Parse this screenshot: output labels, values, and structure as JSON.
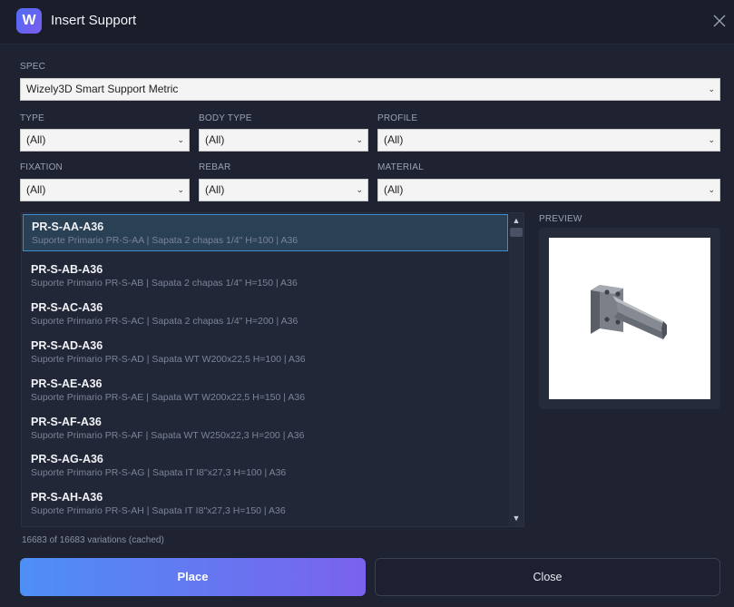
{
  "window": {
    "title": "Insert Support",
    "app_icon_letter": "W"
  },
  "spec": {
    "label": "SPEC",
    "value": "Wizely3D Smart Support Metric"
  },
  "filters": {
    "type": {
      "label": "TYPE",
      "value": "(All)"
    },
    "body_type": {
      "label": "BODY TYPE",
      "value": "(All)"
    },
    "profile": {
      "label": "PROFILE",
      "value": "(All)"
    },
    "fixation": {
      "label": "FIXATION",
      "value": "(All)"
    },
    "rebar": {
      "label": "REBAR",
      "value": "(All)"
    },
    "material": {
      "label": "MATERIAL",
      "value": "(All)"
    }
  },
  "list": {
    "selected_index": 0,
    "items": [
      {
        "code": "PR-S-AA-A36",
        "desc": "Suporte Primario PR-S-AA | Sapata 2 chapas 1/4\" H=100 | A36"
      },
      {
        "code": "PR-S-AB-A36",
        "desc": "Suporte Primario PR-S-AB | Sapata 2 chapas 1/4\" H=150 | A36"
      },
      {
        "code": "PR-S-AC-A36",
        "desc": "Suporte Primario PR-S-AC | Sapata 2 chapas 1/4\" H=200 | A36"
      },
      {
        "code": "PR-S-AD-A36",
        "desc": "Suporte Primario PR-S-AD | Sapata WT W200x22,5 H=100 | A36"
      },
      {
        "code": "PR-S-AE-A36",
        "desc": "Suporte Primario PR-S-AE | Sapata WT W200x22,5 H=150 | A36"
      },
      {
        "code": "PR-S-AF-A36",
        "desc": "Suporte Primario PR-S-AF | Sapata WT W250x22,3 H=200 | A36"
      },
      {
        "code": "PR-S-AG-A36",
        "desc": "Suporte Primario PR-S-AG | Sapata IT I8\"x27,3 H=100 | A36"
      },
      {
        "code": "PR-S-AH-A36",
        "desc": "Suporte Primario PR-S-AH | Sapata IT I8\"x27,3 H=150 | A36"
      }
    ]
  },
  "preview": {
    "label": "PREVIEW"
  },
  "status": "16683 of 16683 variations  (cached)",
  "buttons": {
    "place": "Place",
    "close": "Close"
  },
  "icons": {
    "close": "close-icon",
    "chevron": "chevron-down-icon",
    "scroll_up": "chevron-up-icon",
    "scroll_down": "chevron-down-icon"
  },
  "colors": {
    "accent_start": "#4d8ff5",
    "accent_end": "#7a62ee",
    "selection_border": "#3b8fd0",
    "background": "#1e2231"
  }
}
